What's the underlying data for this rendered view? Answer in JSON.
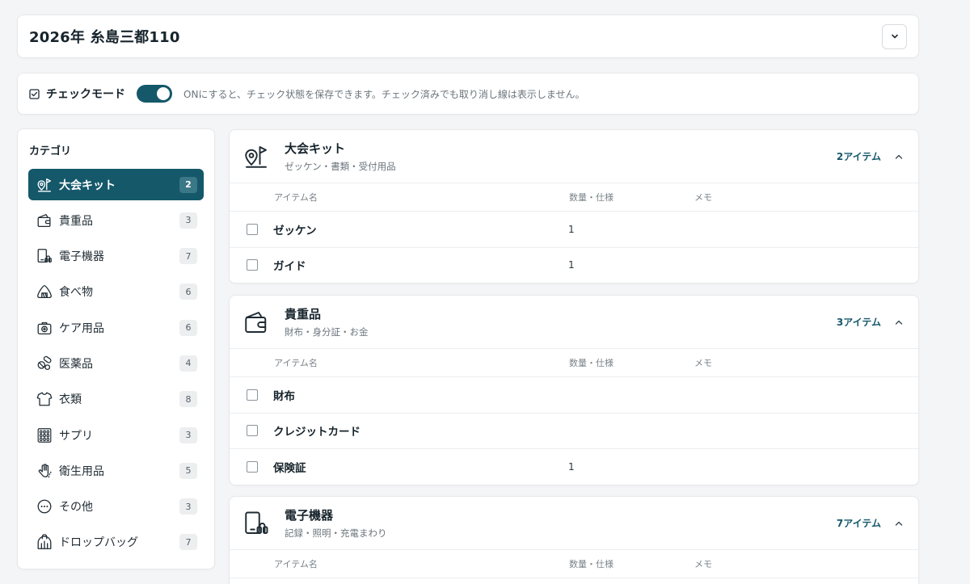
{
  "header": {
    "title": "2026年 糸島三都110"
  },
  "check_mode": {
    "label": "チェックモード",
    "enabled": true,
    "hint": "ONにすると、チェック状態を保存できます。チェック済みでも取り消し線は表示しません。"
  },
  "sidebar": {
    "title": "カテゴリ",
    "items": [
      {
        "label": "大会キット",
        "count": "2",
        "icon": "map-pin-flag-icon",
        "active": true
      },
      {
        "label": "貴重品",
        "count": "3",
        "icon": "wallet-icon"
      },
      {
        "label": "電子機器",
        "count": "7",
        "icon": "devices-icon"
      },
      {
        "label": "食べ物",
        "count": "6",
        "icon": "rice-ball-icon"
      },
      {
        "label": "ケア用品",
        "count": "6",
        "icon": "first-aid-kit-icon"
      },
      {
        "label": "医薬品",
        "count": "4",
        "icon": "pills-icon"
      },
      {
        "label": "衣類",
        "count": "8",
        "icon": "tshirt-icon"
      },
      {
        "label": "サプリ",
        "count": "3",
        "icon": "supplement-pack-icon"
      },
      {
        "label": "衛生用品",
        "count": "5",
        "icon": "hand-wash-icon"
      },
      {
        "label": "その他",
        "count": "3",
        "icon": "more-dots-icon"
      },
      {
        "label": "ドロップバッグ",
        "count": "7",
        "icon": "bag-icon"
      }
    ]
  },
  "columns": {
    "name": "アイテム名",
    "qty": "数量・仕様",
    "memo": "メモ"
  },
  "sections": [
    {
      "title": "大会キット",
      "subtitle": "ゼッケン・書類・受付用品",
      "count": "2アイテム",
      "icon": "map-pin-flag-icon",
      "rows": [
        {
          "name": "ゼッケン",
          "qty": "1",
          "memo": ""
        },
        {
          "name": "ガイド",
          "qty": "1",
          "memo": ""
        }
      ]
    },
    {
      "title": "貴重品",
      "subtitle": "財布・身分証・お金",
      "count": "3アイテム",
      "icon": "wallet-icon",
      "rows": [
        {
          "name": "財布",
          "qty": "",
          "memo": ""
        },
        {
          "name": "クレジットカード",
          "qty": "",
          "memo": ""
        },
        {
          "name": "保険証",
          "qty": "1",
          "memo": ""
        }
      ]
    },
    {
      "title": "電子機器",
      "subtitle": "記録・照明・充電まわり",
      "count": "7アイテム",
      "icon": "devices-icon",
      "rows": []
    }
  ],
  "colors": {
    "accent": "#14586a",
    "background": "#f4f5f7"
  }
}
